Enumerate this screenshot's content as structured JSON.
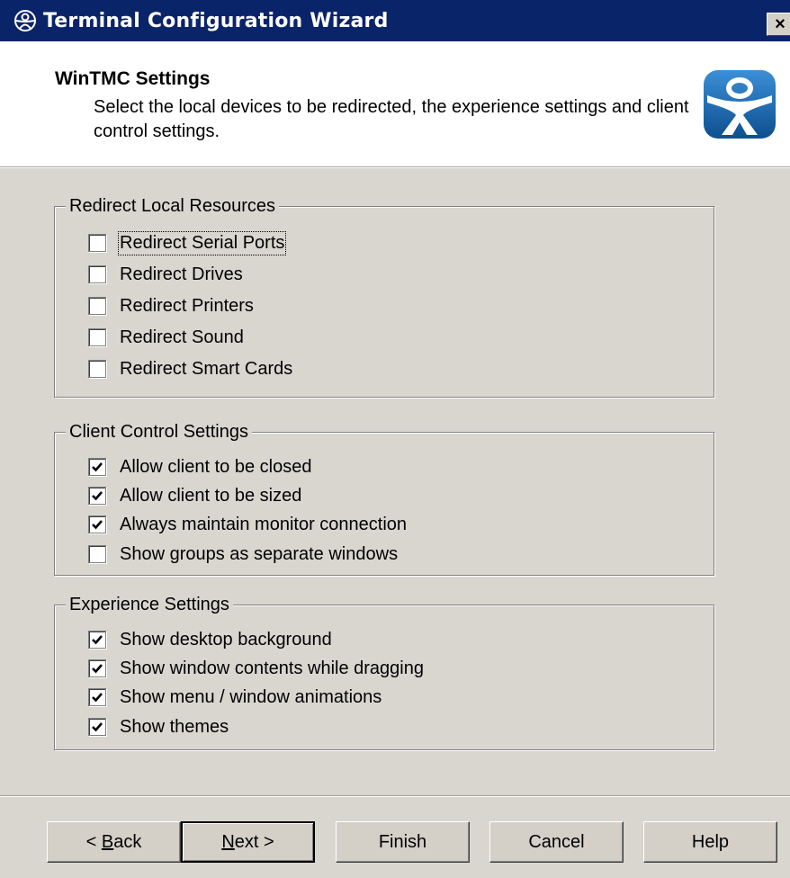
{
  "window": {
    "title": "Terminal Configuration Wizard",
    "close_label": "×",
    "app_icon": "thinmanager-icon",
    "close_icon": "close-icon"
  },
  "header": {
    "title": "WinTMC Settings",
    "description": "Select the local devices to be redirected, the experience settings and client control settings.",
    "logo": "thinmanager-logo-icon"
  },
  "groups": {
    "redirect": {
      "legend": "Redirect Local Resources",
      "items": [
        {
          "label": "Redirect Serial Ports",
          "checked": false
        },
        {
          "label": "Redirect Drives",
          "checked": false
        },
        {
          "label": "Redirect Printers",
          "checked": false
        },
        {
          "label": "Redirect Sound",
          "checked": false
        },
        {
          "label": "Redirect Smart Cards",
          "checked": false
        }
      ]
    },
    "client_control": {
      "legend": "Client Control Settings",
      "items": [
        {
          "label": "Allow client to be closed",
          "checked": true
        },
        {
          "label": "Allow client to be sized",
          "checked": true
        },
        {
          "label": "Always maintain monitor connection",
          "checked": true
        },
        {
          "label": "Show groups as separate windows",
          "checked": false
        }
      ]
    },
    "experience": {
      "legend": "Experience Settings",
      "items": [
        {
          "label": "Show desktop background",
          "checked": true
        },
        {
          "label": "Show window contents while dragging",
          "checked": true
        },
        {
          "label": "Show menu / window animations",
          "checked": true
        },
        {
          "label": "Show themes",
          "checked": true
        }
      ]
    }
  },
  "buttons": {
    "back": {
      "pre": "< ",
      "accel": "B",
      "post": "ack"
    },
    "next": {
      "pre": "",
      "accel": "N",
      "post": "ext >"
    },
    "finish": "Finish",
    "cancel": "Cancel",
    "help": "Help"
  },
  "colors": {
    "titlebar": "#0a246a",
    "dialog_face": "#d9d6d0",
    "logo_blue": "#1e6fb5"
  }
}
